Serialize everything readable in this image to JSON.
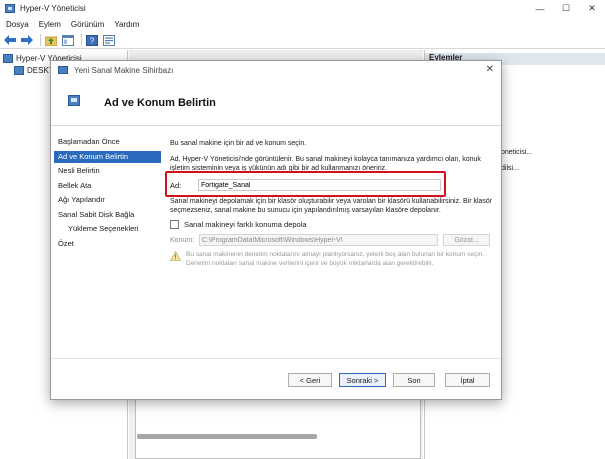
{
  "main_window": {
    "title": "Hyper-V Yöneticisi",
    "controls": {
      "minimize": "—",
      "maximize": "☐",
      "close": "✕"
    }
  },
  "menu": [
    "Dosya",
    "Eylem",
    "Görünüm",
    "Yardım"
  ],
  "tree": {
    "root": "Hyper-V Yöneticisi",
    "server": "DESKT"
  },
  "actions": {
    "header": "Eylemler",
    "items": [
      "oneticisi...",
      "dilsi..."
    ]
  },
  "wizard": {
    "title": "Yeni Sanal Makine Sihirbazı",
    "close": "✕",
    "header_title": "Ad ve Konum Belirtin",
    "nav": [
      {
        "label": "Başlamadan Önce",
        "active": false,
        "sub": false
      },
      {
        "label": "Ad ve Konum Belirtin",
        "active": true,
        "sub": false
      },
      {
        "label": "Nesli Belirtin",
        "active": false,
        "sub": false
      },
      {
        "label": "Bellek Ata",
        "active": false,
        "sub": false
      },
      {
        "label": "Ağı Yapılandır",
        "active": false,
        "sub": false
      },
      {
        "label": "Sanal Sabit Disk Bağla",
        "active": false,
        "sub": false
      },
      {
        "label": "Yükleme Seçenekleri",
        "active": false,
        "sub": true
      },
      {
        "label": "Özet",
        "active": false,
        "sub": false
      }
    ],
    "intro": "Bu sanal makine için bir ad ve konum seçin.",
    "description": "Ad, Hyper-V Yöneticisi'nde görüntülenir. Bu sanal makineyi kolayca tanımanıza yardımcı olan, konuk işletim sisteminin veya iş yükünün adı gibi bir ad kullanmanızı öneririz.",
    "name_label": "Ad:",
    "name_value": "Fortigate_Sanal",
    "storage_info": "Sanal makineyi depolamak için bir klasör oluşturabilir veya varolan bir klasörü kullanabilirsiniz. Bir klasör seçmezseniz, sanal makine bu sunucu için yapılandırılmış varsayılan klasöre depolanır.",
    "checkbox_label": "Sanal makineyi farklı konuma depola",
    "location_label": "Konum:",
    "location_value": "C:\\ProgramData\\Microsoft\\Windows\\Hyper-V\\",
    "browse_label": "Gözat...",
    "warning": "Bu sanal makinenin denetim noktalarını almayı planlıyorsanız, yeterli boş alan bulunan bir konum seçin. Denetim noktaları sanal makine verilerini içerir ve büyük miktarlarda alan gerektirebilir.",
    "buttons": {
      "back": "< Geri",
      "next": "Sonraki >",
      "finish": "Son",
      "cancel": "İptal"
    }
  },
  "colors": {
    "accent": "#2b6bbf",
    "highlight_border": "#d0121d"
  }
}
